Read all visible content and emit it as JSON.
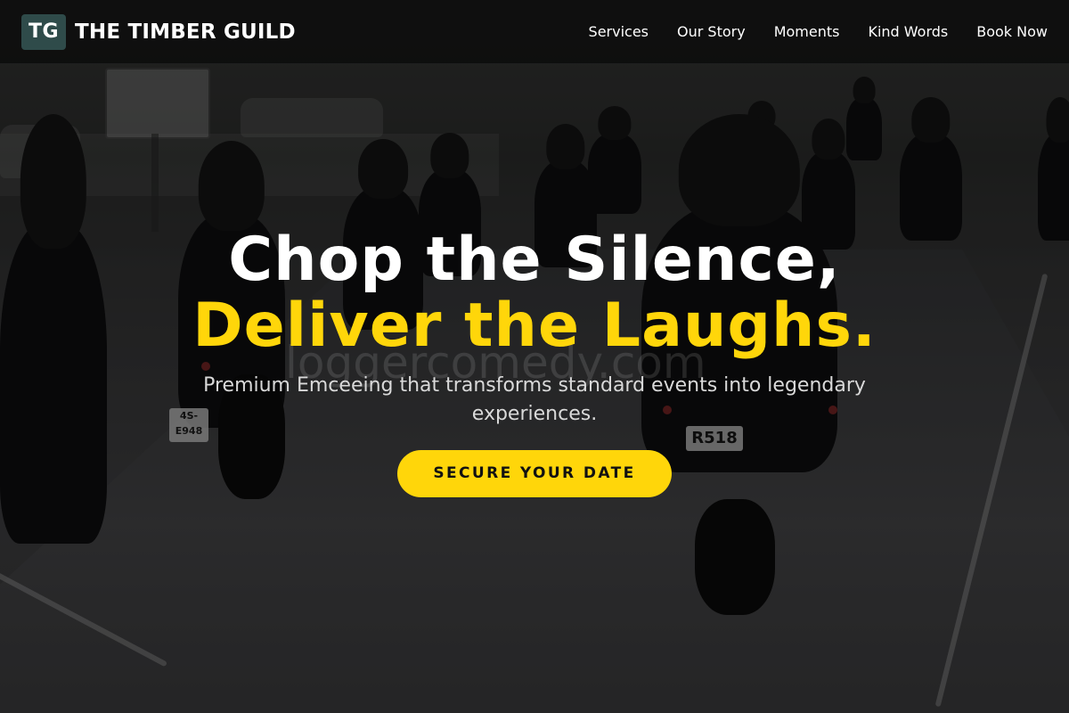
{
  "nav": {
    "brand_mark": "TG",
    "brand_name": "THE TIMBER GUILD",
    "links": [
      {
        "label": "Services"
      },
      {
        "label": "Our Story"
      },
      {
        "label": "Moments"
      },
      {
        "label": "Kind Words"
      },
      {
        "label": "Book Now"
      }
    ]
  },
  "hero": {
    "headline_line1": "Chop the Silence,",
    "headline_line2": "Deliver the Laughs.",
    "subheadline": "Premium Emceeing that transforms standard events into legendary experiences.",
    "cta_label": "SECURE YOUR DATE",
    "background_plates": [
      "R518",
      "4S-E948"
    ],
    "watermark": "loggercomedy.com"
  },
  "colors": {
    "accent": "#ffd60a",
    "brand_mark_bg": "#2f4b4a",
    "nav_bg": "#0e0e0e"
  }
}
